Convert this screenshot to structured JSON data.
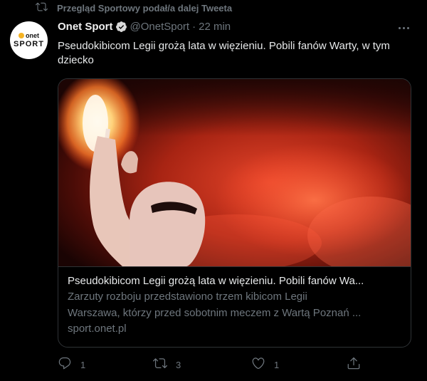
{
  "retweet": {
    "icon": "retweet-icon",
    "text": "Przegląd Sportowy podał/a dalej Tweeta"
  },
  "author": {
    "name": "Onet Sport",
    "handle": "@OnetSport",
    "separator": "·",
    "time": "22 min",
    "verified": true,
    "avatar": {
      "line1": "onet",
      "line2": "SPORT"
    }
  },
  "tweet": {
    "text": "Pseudokibicom Legii grożą lata w więzieniu. Pobili fanów Warty, w tym dziecko"
  },
  "card": {
    "title": "Pseudokibicom Legii grożą lata w więzieniu. Pobili fanów Wa...",
    "description_line1": "Zarzuty rozboju przedstawiono trzem kibicom Legii",
    "description_line2": "Warszawa, którzy przed sobotnim meczem z Wartą Poznań ...",
    "domain": "sport.onet.pl"
  },
  "actions": {
    "reply_count": "1",
    "retweet_count": "3",
    "like_count": "1"
  },
  "colors": {
    "background": "#000000",
    "secondary_text": "#6e767d",
    "primary_text": "#e7e9ea",
    "verified_badge": "#d9d9d9",
    "card_border": "#2f3336"
  }
}
